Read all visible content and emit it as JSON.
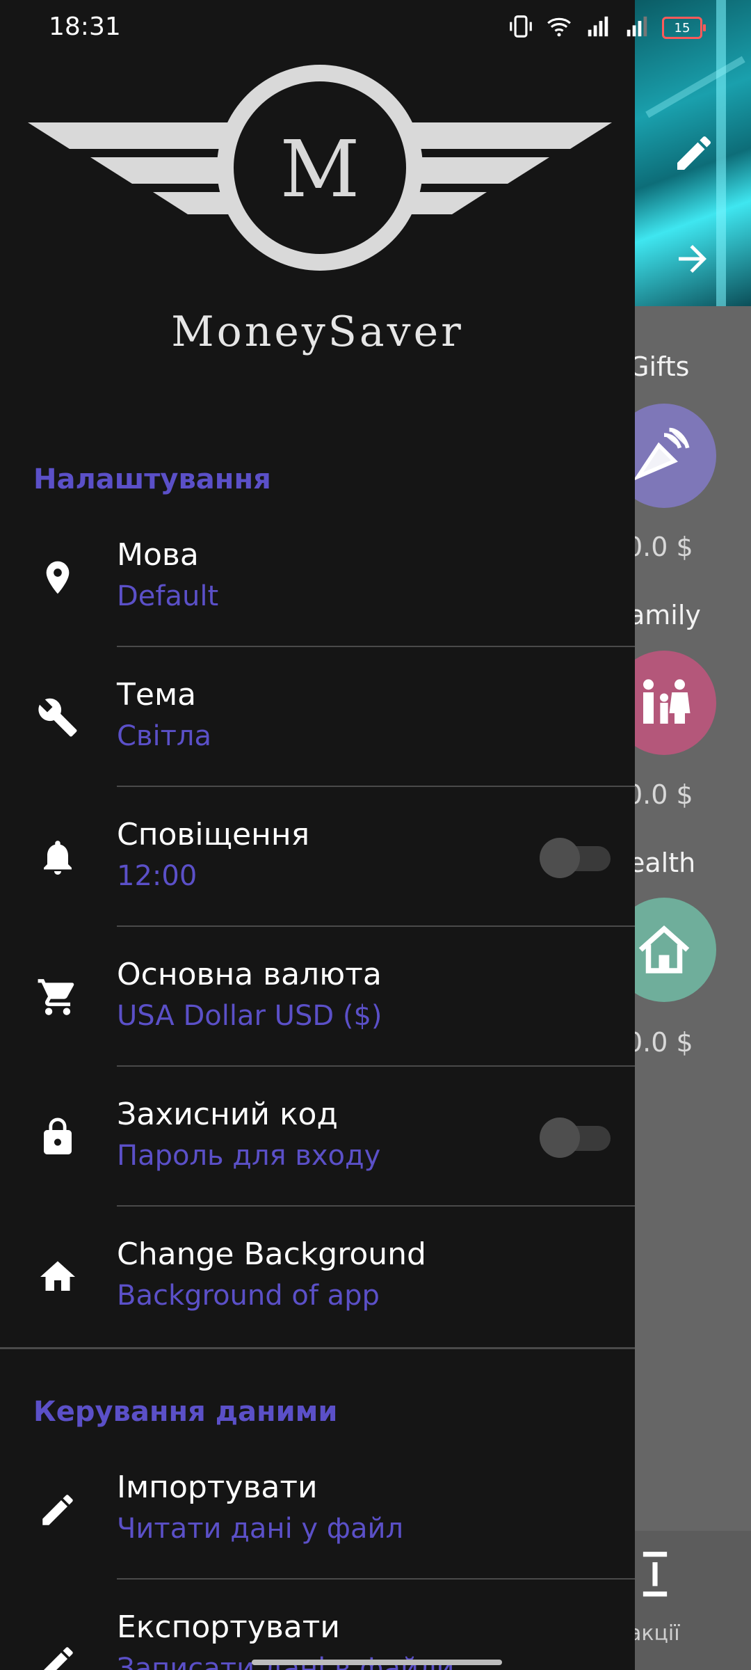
{
  "status_bar": {
    "time": "18:31",
    "battery": "15"
  },
  "app": {
    "name": "MoneySaver",
    "logo_letter": "M"
  },
  "sections": [
    {
      "title": "Налаштування"
    },
    {
      "title": "Керування даними"
    }
  ],
  "settings": [
    {
      "title": "Мова",
      "subtitle": "Default",
      "icon": "location-pin-icon"
    },
    {
      "title": "Тема",
      "subtitle": "Світла",
      "icon": "wrench-icon"
    },
    {
      "title": "Сповіщення",
      "subtitle": "12:00",
      "icon": "bell-icon",
      "toggle": false
    },
    {
      "title": "Основна валюта",
      "subtitle": "USA Dollar USD ($)",
      "icon": "cart-icon"
    },
    {
      "title": "Захисний код",
      "subtitle": "Пароль для входу",
      "icon": "lock-icon",
      "toggle": false
    },
    {
      "title": "Change Background",
      "subtitle": "Background of app",
      "icon": "home-icon"
    }
  ],
  "data_management": [
    {
      "title": "Імпортувати",
      "subtitle": "Читати дані у файл",
      "icon": "pencil-icon"
    },
    {
      "title": "Експортувати",
      "subtitle": "Записати дані в файли",
      "icon": "pencil-icon"
    }
  ],
  "background_app": {
    "categories": [
      {
        "label": "Gifts",
        "amount": "0.0 $",
        "color": "#7e77b8"
      },
      {
        "label": "amily",
        "amount": "0.0 $",
        "color": "#b4577a"
      },
      {
        "label": "ealth",
        "amount": "0.0 $",
        "color": "#6fae9b"
      }
    ],
    "bottom_nav_label": "акції"
  },
  "colors": {
    "accent": "#5b50c8",
    "drawer_bg": "#151515",
    "scrim": "#666666"
  }
}
